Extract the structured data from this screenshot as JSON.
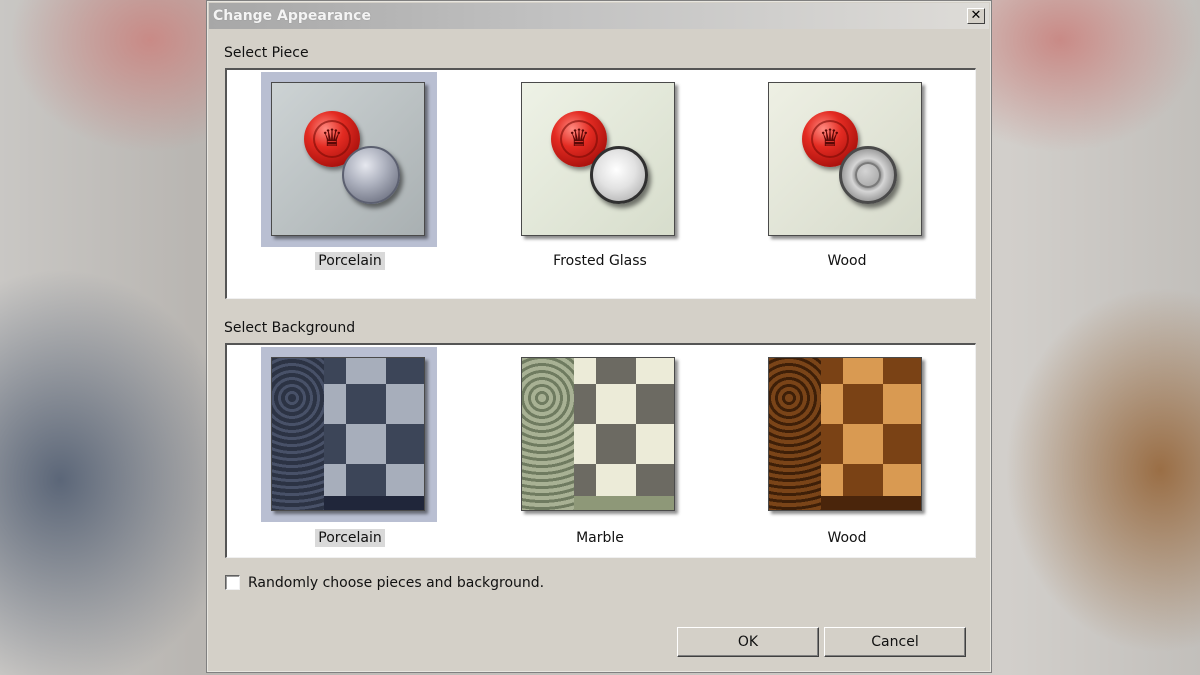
{
  "dialog": {
    "title": "Change Appearance",
    "close_label": "✕",
    "piece_section_label": "Select Piece",
    "background_section_label": "Select Background",
    "pieces": [
      {
        "label": "Porcelain",
        "selected": true,
        "crown": "♛"
      },
      {
        "label": "Frosted Glass",
        "selected": false,
        "crown": "♛"
      },
      {
        "label": "Wood",
        "selected": false,
        "crown": "♛"
      }
    ],
    "backgrounds": [
      {
        "label": "Porcelain",
        "selected": true
      },
      {
        "label": "Marble",
        "selected": false
      },
      {
        "label": "Wood",
        "selected": false
      }
    ],
    "random_checkbox_label": "Randomly choose pieces and background.",
    "random_checked": false,
    "ok_label": "OK",
    "cancel_label": "Cancel"
  },
  "colors": {
    "selection_highlight": "#b9bfd2",
    "dialog_face": "#d4d0c8",
    "red_piece": "#e32b22"
  }
}
